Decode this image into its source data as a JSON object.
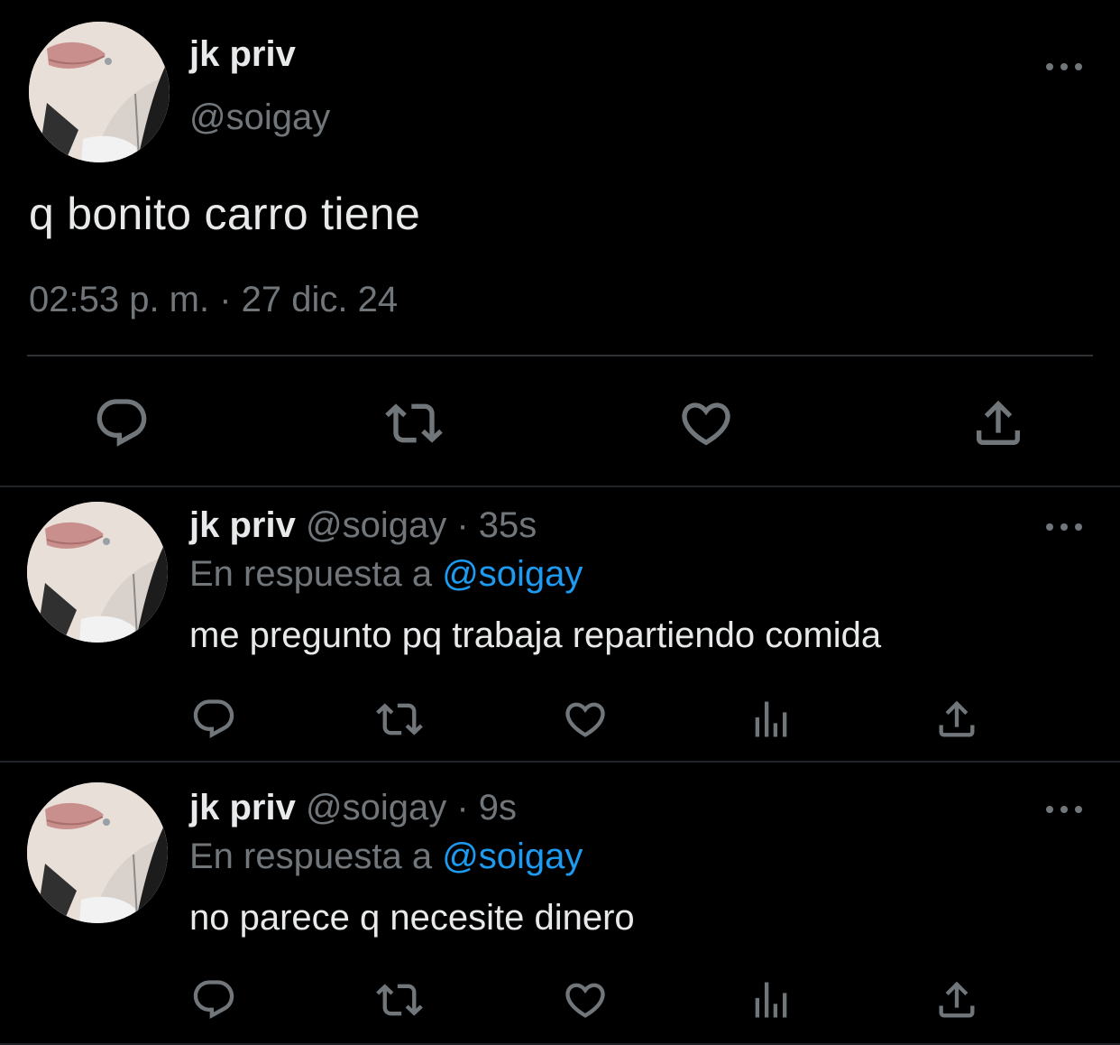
{
  "colors": {
    "background": "#000000",
    "text_primary": "#e7e9ea",
    "text_secondary": "#71767b",
    "link": "#1d9bf0",
    "divider": "#2f3336"
  },
  "main_tweet": {
    "author_name": "jk priv",
    "author_handle": "@soigay",
    "text": "q bonito carro tiene",
    "timestamp": "02:53 p. m. · 27 dic. 24",
    "actions": [
      "reply-icon",
      "retweet-icon",
      "like-icon",
      "share-icon"
    ]
  },
  "replies": [
    {
      "author_name": "jk priv",
      "author_handle": "@soigay",
      "separator": "·",
      "time": "35s",
      "replying_prefix": "En respuesta a",
      "replying_to": "@soigay",
      "text": "me pregunto pq trabaja repartiendo comida",
      "actions": [
        "reply-icon",
        "retweet-icon",
        "like-icon",
        "views-icon",
        "share-icon"
      ]
    },
    {
      "author_name": "jk priv",
      "author_handle": "@soigay",
      "separator": "·",
      "time": "9s",
      "replying_prefix": "En respuesta a",
      "replying_to": "@soigay",
      "text": "no parece q necesite dinero",
      "actions": [
        "reply-icon",
        "retweet-icon",
        "like-icon",
        "views-icon",
        "share-icon"
      ]
    }
  ]
}
